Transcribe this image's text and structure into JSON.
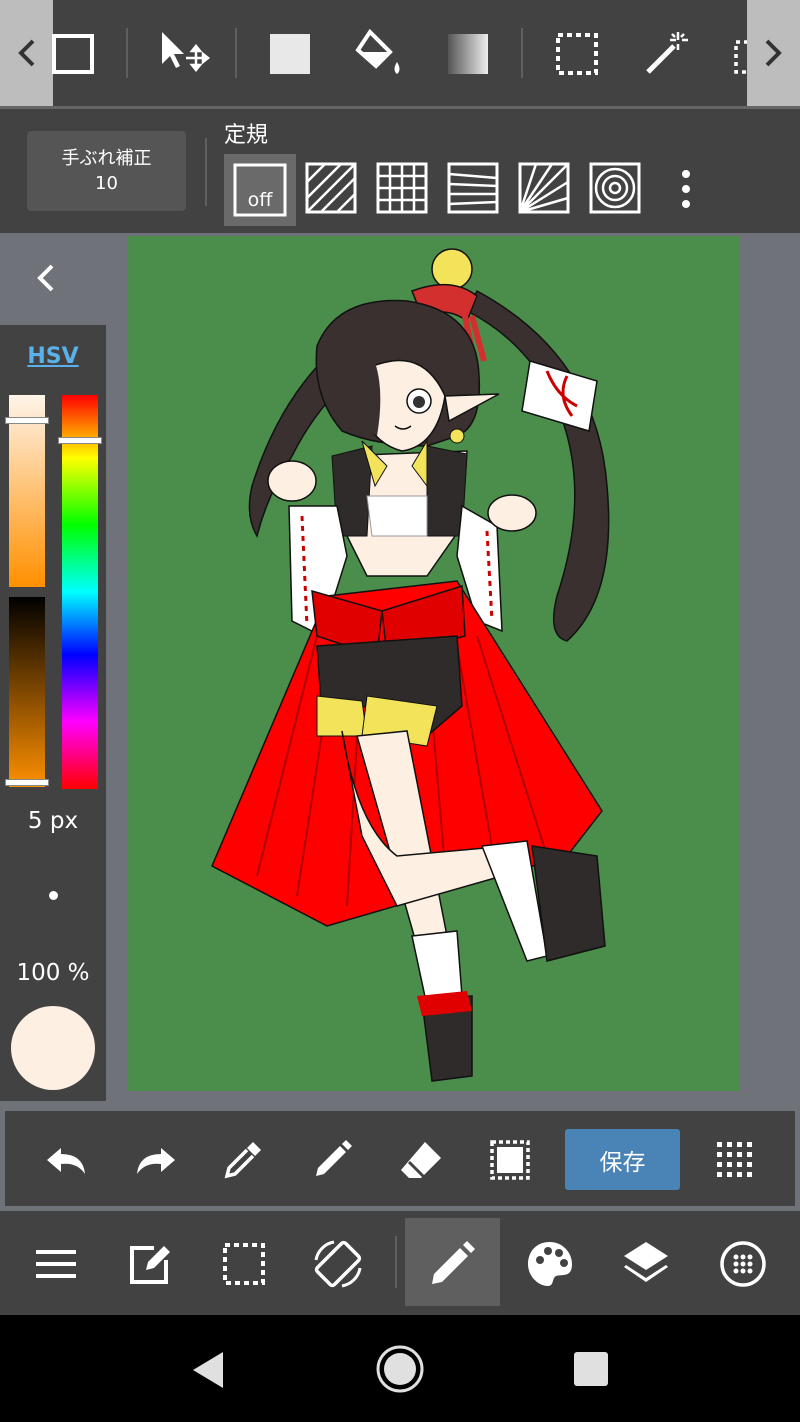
{
  "stabilizer": {
    "label": "手ぶれ補正",
    "value": "10"
  },
  "ruler": {
    "title": "定規",
    "off_label": "off"
  },
  "color": {
    "mode_label": "HSV",
    "brush_size": "5 px",
    "opacity": "100 %",
    "current_color": "#fdf0e3",
    "canvas_background": "#4b8d4b",
    "saturation": 0.97,
    "brightness": 0.97,
    "hue_position": 0.12
  },
  "actions": {
    "save_label": "保存"
  },
  "icons": {
    "top": [
      "chevron-left-icon",
      "rectangle-icon",
      "move-icon",
      "fill-rect-icon",
      "bucket-icon",
      "gradient-icon",
      "select-rect-icon",
      "magic-wand-icon",
      "select-pen-icon",
      "chevron-right-icon"
    ],
    "rulers": [
      "ruler-off-icon",
      "ruler-parallel-icon",
      "ruler-grid-icon",
      "ruler-perspective-icon",
      "ruler-radial-icon",
      "ruler-concentric-icon",
      "more-icon"
    ],
    "actions": [
      "undo-icon",
      "redo-icon",
      "eyedropper-icon",
      "pen-icon",
      "eraser-icon",
      "selection-icon",
      "grid-icon"
    ],
    "menu": [
      "menu-icon",
      "edit-icon",
      "selection-icon",
      "rotate-icon",
      "pen-icon",
      "palette-icon",
      "layers-icon",
      "material-icon"
    ],
    "nav": [
      "back-icon",
      "home-icon",
      "recents-icon"
    ]
  },
  "active_tool": "pen"
}
